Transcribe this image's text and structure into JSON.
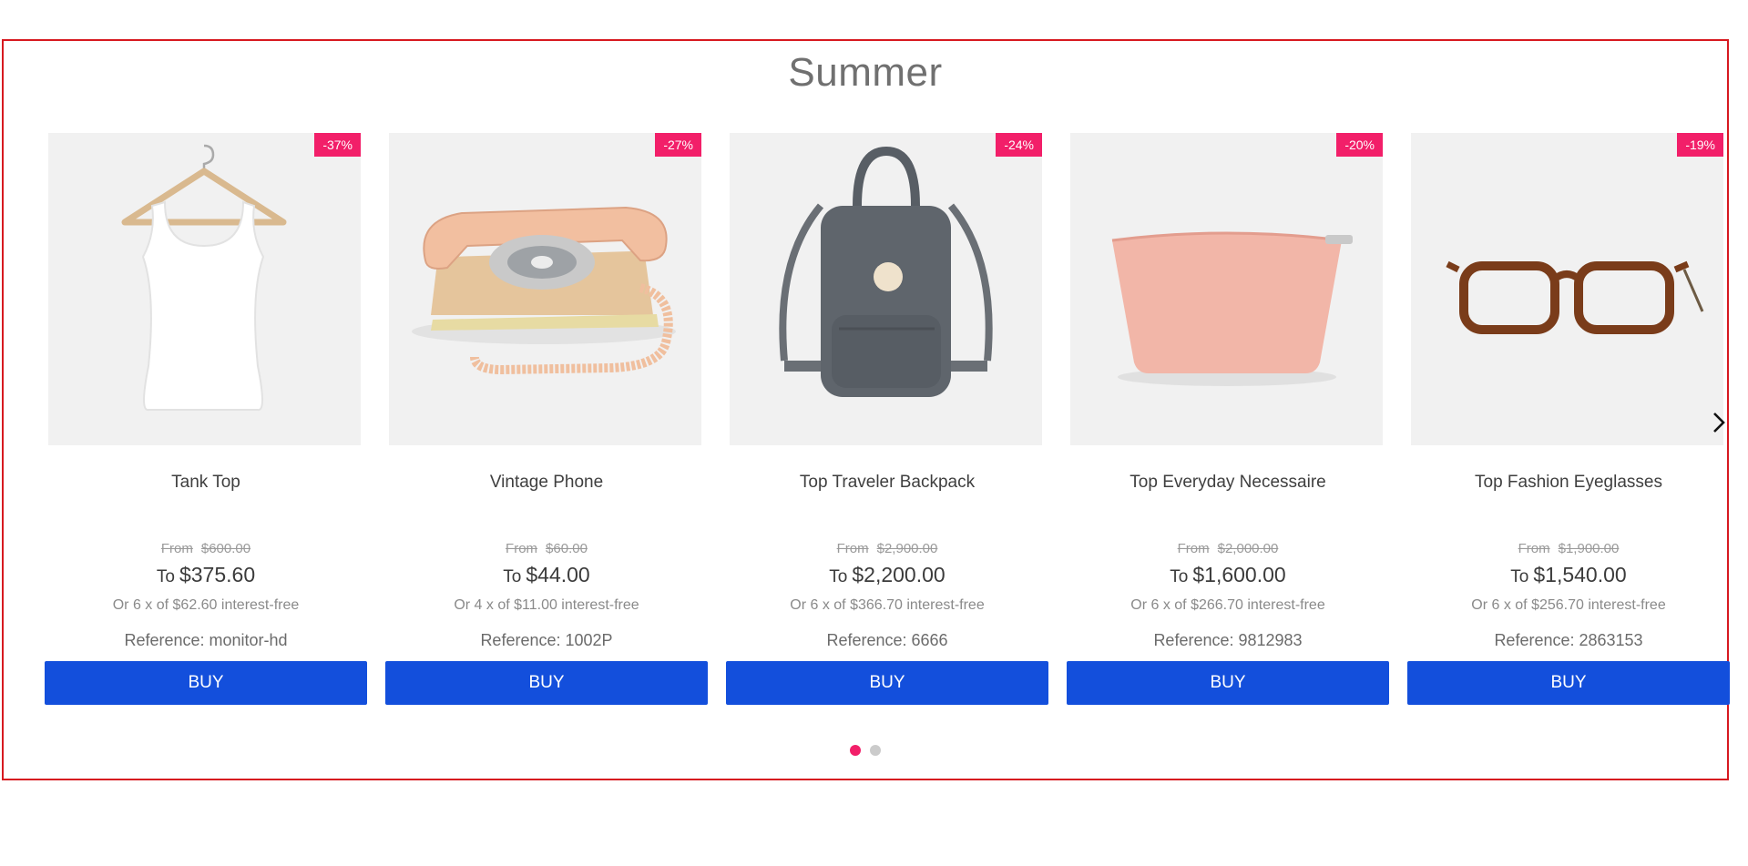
{
  "shelf": {
    "title": "Summer",
    "prev_arrow_icon": "chevron-left-icon",
    "next_arrow_icon": "chevron-right-icon",
    "products": [
      {
        "name": "Tank Top",
        "discount_badge": "-37%",
        "list_price_label": "From",
        "list_price": "$600.00",
        "selling_price_label": "To",
        "selling_price": "$375.60",
        "installments": "Or 6 x of $62.60 interest-free",
        "reference": "Reference: monitor-hd",
        "buy_label": "BUY",
        "image": "white-tank-top-on-hanger"
      },
      {
        "name": "Vintage Phone",
        "discount_badge": "-27%",
        "list_price_label": "From",
        "list_price": "$60.00",
        "selling_price_label": "To",
        "selling_price": "$44.00",
        "installments": "Or 4 x of $11.00 interest-free",
        "reference": "Reference: 1002P",
        "buy_label": "BUY",
        "image": "peach-rotary-telephone"
      },
      {
        "name": "Top Traveler Backpack",
        "discount_badge": "-24%",
        "list_price_label": "From",
        "list_price": "$2,900.00",
        "selling_price_label": "To",
        "selling_price": "$2,200.00",
        "installments": "Or 6 x of $366.70 interest-free",
        "reference": "Reference: 6666",
        "buy_label": "BUY",
        "image": "grey-backpack"
      },
      {
        "name": "Top Everyday Necessaire",
        "discount_badge": "-20%",
        "list_price_label": "From",
        "list_price": "$2,000.00",
        "selling_price_label": "To",
        "selling_price": "$1,600.00",
        "installments": "Or 6 x of $266.70 interest-free",
        "reference": "Reference: 9812983",
        "buy_label": "BUY",
        "image": "pink-pouch"
      },
      {
        "name": "Top Fashion Eyeglasses",
        "discount_badge": "-19%",
        "list_price_label": "From",
        "list_price": "$1,900.00",
        "selling_price_label": "To",
        "selling_price": "$1,540.00",
        "installments": "Or 6 x of $256.70 interest-free",
        "reference": "Reference: 2863153",
        "buy_label": "BUY",
        "image": "tortoiseshell-eyeglasses"
      }
    ],
    "pagination": {
      "pages": 2,
      "active_page": 1
    }
  },
  "colors": {
    "frame_border": "#d71920",
    "badge": "#f21f69",
    "buy_button": "#134fdc",
    "dot_active": "#f21f69",
    "dot_inactive": "#cbcbcb"
  }
}
